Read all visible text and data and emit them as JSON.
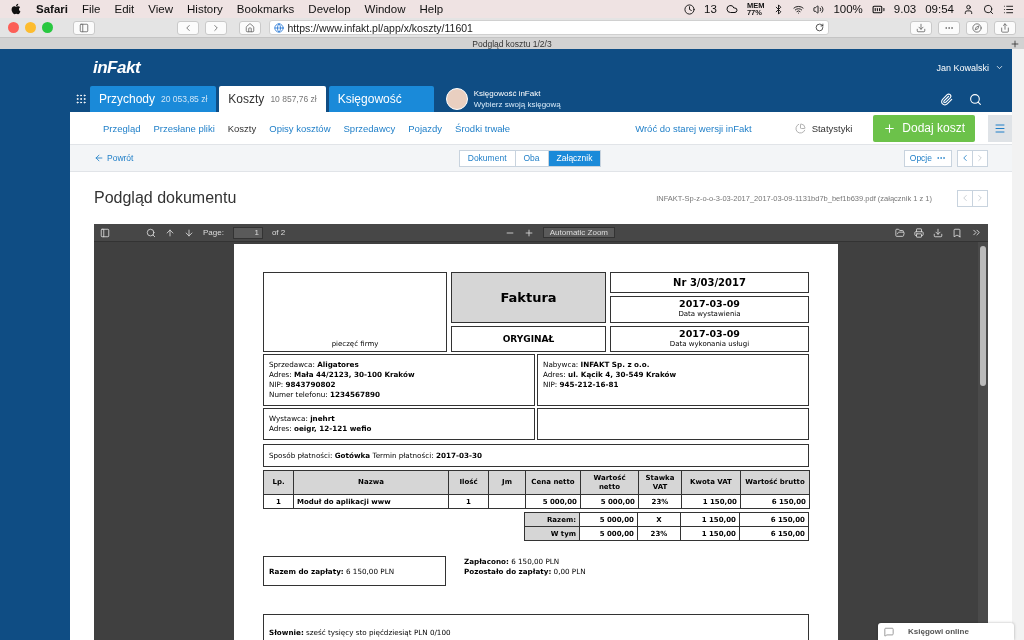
{
  "menubar": {
    "app": "Safari",
    "menus": [
      "File",
      "Edit",
      "View",
      "History",
      "Bookmarks",
      "Develop",
      "Window",
      "Help"
    ],
    "badge": "13",
    "memory_label": "MEM",
    "memory_value": "77%",
    "battery": "100%",
    "date": "9.03",
    "time": "09:54"
  },
  "browser": {
    "url": "https://www.infakt.pl/app/x/koszty/11601",
    "tab_title": "Podgląd kosztu 1/2/3"
  },
  "header": {
    "logo": "inFakt",
    "user": "Jan Kowalski",
    "tabs": [
      {
        "label": "Przychody",
        "amount": "20 053,85 zł",
        "selected": false
      },
      {
        "label": "Koszty",
        "amount": "10 857,76 zł",
        "selected": true
      },
      {
        "label": "Księgowość",
        "selected": false
      }
    ],
    "accountant": {
      "name": "Księgowość inFakt",
      "subtitle": "Wybierz swoją księgową"
    }
  },
  "subnav": {
    "items": [
      {
        "label": "Przegląd",
        "selected": false
      },
      {
        "label": "Przesłane pliki",
        "selected": false
      },
      {
        "label": "Koszty",
        "selected": true
      },
      {
        "label": "Opisy kosztów",
        "selected": false
      },
      {
        "label": "Sprzedawcy",
        "selected": false
      },
      {
        "label": "Pojazdy",
        "selected": false
      },
      {
        "label": "Środki trwałe",
        "selected": false
      }
    ],
    "old_version_link": "Wróć do starej wersji inFakt",
    "stats": "Statystyki",
    "add_button": "Dodaj koszt"
  },
  "toolbar": {
    "back": "Powrót",
    "views": [
      {
        "label": "Dokument",
        "selected": false
      },
      {
        "label": "Oba",
        "selected": false
      },
      {
        "label": "Załącznik",
        "selected": true
      }
    ],
    "options": "Opcje"
  },
  "document": {
    "title": "Podgląd dokumentu",
    "file": "INFAKT-Sp-z-o-o-3-03-2017_2017-03-09-1131bd7b_bef1b639.pdf (załącznik 1 z 1)"
  },
  "pdf_toolbar": {
    "page_label": "Page:",
    "page": "1",
    "page_count": "of 2",
    "zoom": "Automatic Zoom"
  },
  "invoice": {
    "stamp": "pieczęć firmy",
    "title": "Faktura",
    "original": "ORYGINAŁ",
    "number": "Nr 3/03/2017",
    "dates": [
      {
        "value": "2017-03-09",
        "label": "Data wystawienia"
      },
      {
        "value": "2017-03-09",
        "label": "Data wykonania usługi"
      }
    ],
    "seller": [
      "Sprzedawca: **Aligatores**",
      "Adres: **Mała 44/2123, 30-100 Kraków**",
      "NIP: **9843790802**",
      "Numer telefonu: **1234567890**"
    ],
    "buyer": [
      "Nabywca: **INFAKT Sp. z o.o.**",
      "Adres: **ul. Kącik 4, 30-549 Kraków**",
      "NIP: **945-212-16-81**"
    ],
    "issuer": [
      "Wystawca: **jnehrt**",
      "Adres: **oeigr, 12-121 wefio**"
    ],
    "payment": "Sposób płatności: **Gotówka** Termin płatności: **2017-03-30**",
    "columns": [
      "Lp.",
      "Nazwa",
      "Ilość",
      "Jm",
      "Cena netto",
      "Wartość netto",
      "Stawka VAT",
      "Kwota VAT",
      "Wartość brutto"
    ],
    "rows": [
      {
        "lp": "1",
        "name": "Moduł do aplikacji www",
        "qty": "1",
        "net_price": "5 000,00",
        "net_value": "5 000,00",
        "vat_rate": "23%",
        "vat_amount": "1 150,00",
        "gross": "6 150,00"
      }
    ],
    "totals": [
      {
        "label": "Razem:",
        "net_value": "5 000,00",
        "vat_rate": "X",
        "vat_amount": "1 150,00",
        "gross": "6 150,00"
      },
      {
        "label": "W tym",
        "net_value": "5 000,00",
        "vat_rate": "23%",
        "vat_amount": "1 150,00",
        "gross": "6 150,00"
      }
    ],
    "total_due": "**Razem do zapłaty:** 6 150,00 PLN",
    "paid": [
      "**Zapłacono:** 6 150,00 PLN",
      "**Pozostało do zapłaty:** 0,00 PLN"
    ],
    "in_words": "**Słownie:** sześć tysięcy sto pięćdziesiąt PLN 0/100"
  },
  "chat": {
    "label": "Księgowi online"
  }
}
